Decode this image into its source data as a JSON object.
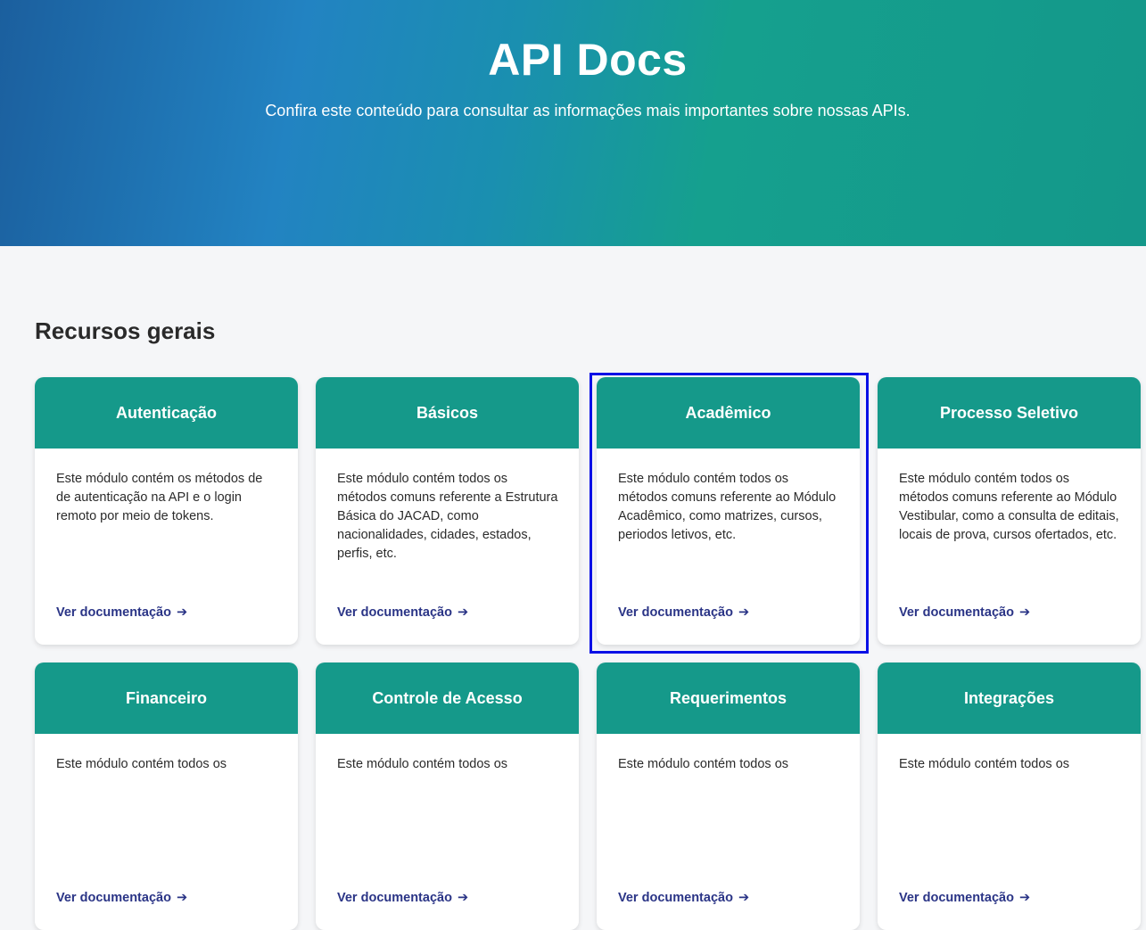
{
  "hero": {
    "title": "API Docs",
    "subtitle": "Confira este conteúdo para consultar as informações mais importantes sobre nossas APIs.",
    "gradient_colors": [
      "#1b5f9e",
      "#2283c2",
      "#15a08e"
    ]
  },
  "section": {
    "title": "Recursos gerais"
  },
  "colors": {
    "card_header": "#15998a",
    "link": "#2a3486",
    "highlight_border": "#0a10e6",
    "page_background": "#f5f6f8"
  },
  "link_label": "Ver documentação",
  "link_arrow": "➔",
  "cards": [
    {
      "title": "Autenticação",
      "description": "Este módulo contém os métodos de de autenticação na API e o login remoto por meio de tokens.",
      "link_label": "Ver documentação",
      "highlighted": false
    },
    {
      "title": "Básicos",
      "description": "Este módulo contém todos os métodos comuns referente a Estrutura Básica do JACAD, como nacionalidades, cidades, estados, perfis, etc.",
      "link_label": "Ver documentação",
      "highlighted": false
    },
    {
      "title": "Acadêmico",
      "description": "Este módulo contém todos os métodos comuns referente ao Módulo Acadêmico, como matrizes, cursos, periodos letivos, etc.",
      "link_label": "Ver documentação",
      "highlighted": true
    },
    {
      "title": "Processo Seletivo",
      "description": "Este módulo contém todos os métodos comuns referente ao Módulo Vestibular, como a consulta de editais, locais de prova, cursos ofertados, etc.",
      "link_label": "Ver documentação",
      "highlighted": false
    },
    {
      "title": "Financeiro",
      "description": "Este módulo contém todos os",
      "link_label": "Ver documentação",
      "highlighted": false
    },
    {
      "title": "Controle de Acesso",
      "description": "Este módulo contém todos os",
      "link_label": "Ver documentação",
      "highlighted": false
    },
    {
      "title": "Requerimentos",
      "description": "Este módulo contém todos os",
      "link_label": "Ver documentação",
      "highlighted": false
    },
    {
      "title": "Integrações",
      "description": "Este módulo contém todos os",
      "link_label": "Ver documentação",
      "highlighted": false
    }
  ]
}
